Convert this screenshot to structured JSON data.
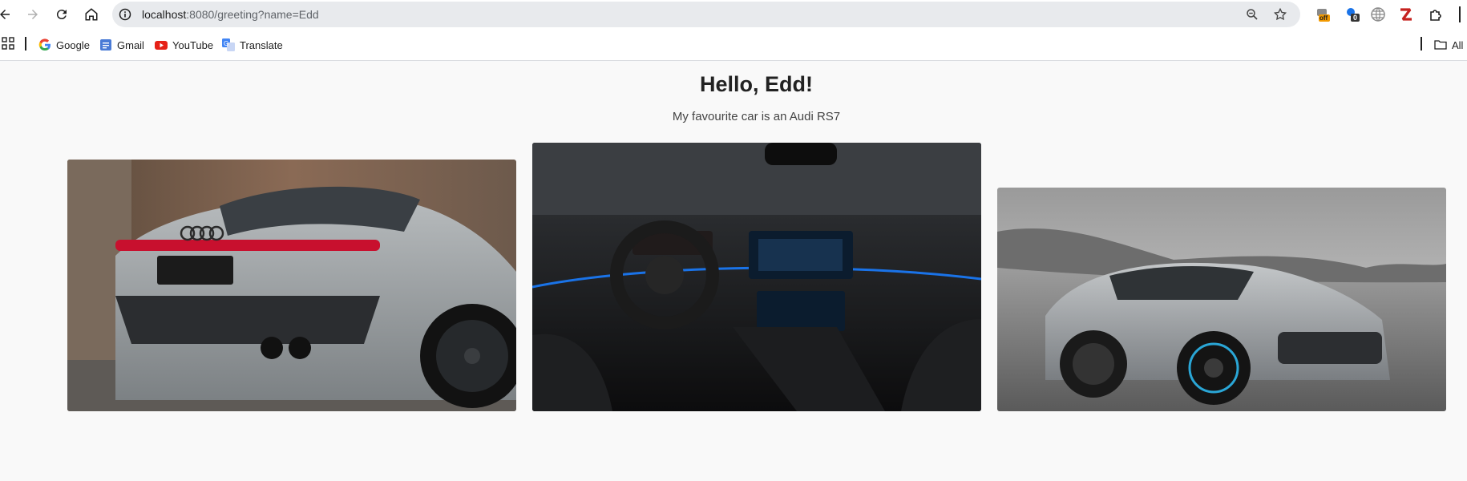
{
  "browser": {
    "url_host": "localhost",
    "url_rest": ":8080/greeting?name=Edd",
    "extension_badge_off": "off",
    "extension_badge_count": "0"
  },
  "bookmarks": [
    {
      "label": "Google",
      "icon": "google-icon"
    },
    {
      "label": "Gmail",
      "icon": "gmail-icon"
    },
    {
      "label": "YouTube",
      "icon": "youtube-icon"
    },
    {
      "label": "Translate",
      "icon": "translate-icon"
    }
  ],
  "bookmarks_right": {
    "label": "All"
  },
  "page": {
    "title": "Hello, Edd!",
    "subtitle": "My favourite car is an Audi RS7"
  },
  "images": [
    {
      "name": "car-rear-image",
      "description": "grey-car-rear"
    },
    {
      "name": "car-interior-image",
      "description": "car-interior"
    },
    {
      "name": "car-front-image",
      "description": "grey-car-front"
    }
  ],
  "colors": {
    "accent_blue": "#1a73e8",
    "brake_light": "#c8102e"
  }
}
